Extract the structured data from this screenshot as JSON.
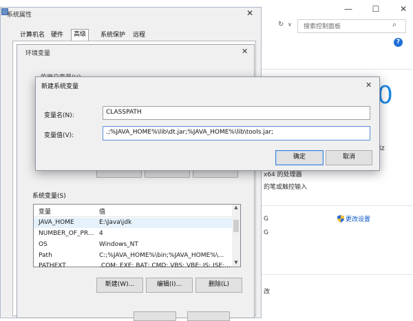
{
  "background_window": {
    "search_placeholder": "搜索控制面板",
    "refresh_icon": "↻",
    "dropdown_icon": "∨",
    "search_icon": "⌕",
    "help_icon": "?",
    "minimize": "—",
    "maximize": "☐",
    "close": "✕",
    "windows_version_fragment": "0",
    "cpu_freq_fragment": "Hz",
    "cpu_type_fragment": "x64 的处理器",
    "touch_fragment": "的笔或触控输入",
    "frag_g1": "G",
    "frag_g2": "G",
    "frag_g3": "改",
    "change_settings": "更改设置"
  },
  "system_properties": {
    "title": "系统属性",
    "tabs": [
      "计算机名",
      "硬件",
      "高级",
      "系统保护",
      "远程"
    ],
    "active_tab": "高级"
  },
  "environment_variables": {
    "title": "环境变量",
    "user_vars_fragment": "…的用户变量(U)",
    "system_vars_label": "系统变量(S)",
    "columns": [
      "变量",
      "值"
    ],
    "rows": [
      {
        "name": "JAVA_HOME",
        "value": "E:\\Java\\jdk"
      },
      {
        "name": "NUMBER_OF_PR...",
        "value": "4"
      },
      {
        "name": "OS",
        "value": "Windows_NT"
      },
      {
        "name": "Path",
        "value": "C:;%JAVA_HOME%\\bin;%JAVA_HOME%\\..."
      },
      {
        "name": "PATHEXT",
        "value": ".COM;.EXE;.BAT;.CMD;.VBS;.VBE;.JS;.JSE;..."
      }
    ],
    "selected_row": 0,
    "new_button": "新建(W)...",
    "edit_button": "编辑(I)...",
    "delete_button": "删除(L)"
  },
  "new_system_variable": {
    "title": "新建系统变量",
    "name_label": "变量名(N):",
    "value_label": "变量值(V):",
    "name_value": "CLASSPATH",
    "value_value": ".;%JAVA_HOME%\\lib\\dt.jar;%JAVA_HOME%\\lib\\tools.jar;",
    "ok_button": "确定",
    "cancel_button": "取消"
  },
  "colors": {
    "accent_blue": "#1e88e5",
    "link_blue": "#0a58ca",
    "selected_row": "#e5f1fb",
    "dialog_bg": "#f0f0f0"
  }
}
